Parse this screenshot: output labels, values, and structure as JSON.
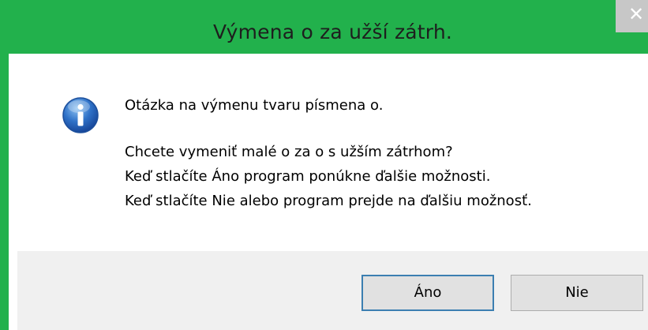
{
  "window": {
    "title": "Výmena o za užší zátrh.",
    "close_glyph": "✕"
  },
  "message": {
    "icon": "info-icon",
    "line1": "Otázka na výmenu tvaru písmena o.",
    "line2": "Chcete vymeniť malé o za o s užším zátrhom?",
    "line3": "Keď stlačíte Áno program ponúkne ďalšie možnosti.",
    "line4": "Keď stlačíte Nie alebo program prejde na ďalšiu možnosť."
  },
  "buttons": {
    "yes_label": "Áno",
    "no_label": "Nie"
  },
  "colors": {
    "accent": "#22b14c",
    "footer_bg": "#f0f0f0",
    "default_button_border": "#3c7fb1"
  }
}
